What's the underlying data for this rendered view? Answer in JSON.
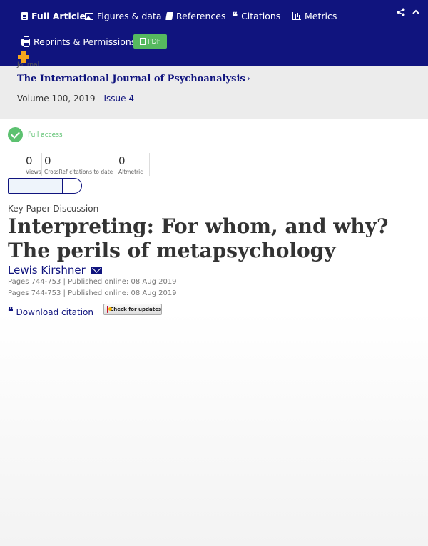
{
  "nav": {
    "items": [
      {
        "label": "Full Article",
        "icon": "document-icon",
        "active": true
      },
      {
        "label": "Figures & data",
        "icon": "image-icon"
      },
      {
        "label": "References",
        "icon": "book-icon"
      },
      {
        "label": "Citations",
        "icon": "quote-icon"
      },
      {
        "label": "Metrics",
        "icon": "bar-chart-icon"
      },
      {
        "label": "Reprints & Permissions",
        "icon": "print-icon"
      }
    ],
    "pdf_label": "PDF",
    "quote_glyph": "❝",
    "accent_color": "#10147e",
    "pdf_color": "#56b95f"
  },
  "journal": {
    "label": "Journal",
    "title": "The International Journal of Psychoanalysis",
    "chevron": "›",
    "volume": "Volume 100, 2019 - ",
    "issue": "Issue 4"
  },
  "access": {
    "label": "Full access",
    "color": "#5cc170"
  },
  "metrics": [
    {
      "value": "0",
      "label": "Views"
    },
    {
      "value": "0",
      "label": "CrossRef citations to date"
    },
    {
      "value": "0",
      "label": "Altmetric"
    }
  ],
  "article": {
    "type": "Key Paper Discussion",
    "title": "Interpreting: For whom, and why? The perils of metapsychology",
    "author": "Lewis Kirshner",
    "pages_lines": [
      "Pages 744-753 | Published online: 08 Aug 2019",
      "Pages 744-753 | Published online: 08 Aug 2019"
    ],
    "download_citation": "Download citation",
    "check_updates": "Check for updates"
  }
}
